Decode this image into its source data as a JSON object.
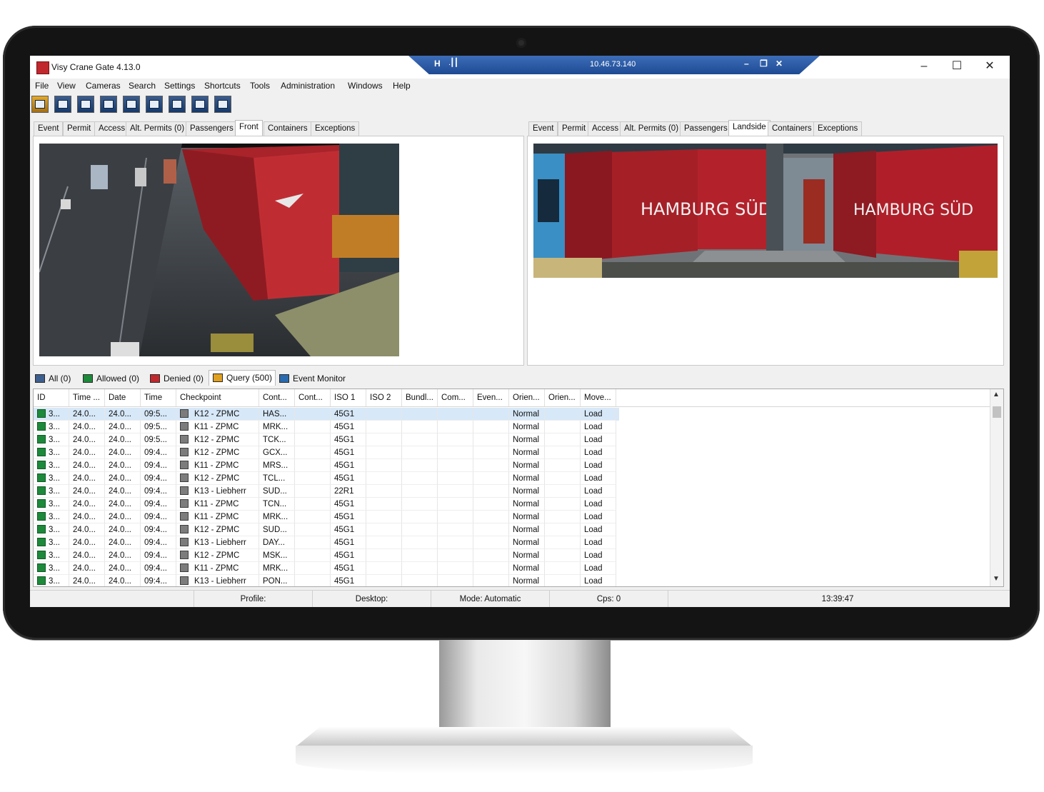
{
  "app": {
    "title": "Visy Crane Gate 4.13.0"
  },
  "remote_bar": {
    "pin_glyph": "⌐",
    "pin_label": "H",
    "signal_glyph": ".┃┃",
    "ip": "10.46.73.140",
    "min": "–",
    "restore": "❐",
    "close": "✕"
  },
  "window_controls": {
    "min": "–",
    "max": "☐",
    "close": "✕"
  },
  "menu": [
    "File",
    "View",
    "Cameras",
    "Search",
    "Settings",
    "Shortcuts",
    "Tools",
    "Administration",
    "Windows",
    "Help"
  ],
  "toolbar_icons": [
    "event-folder-icon",
    "gate-icon",
    "list-icon",
    "camera-icon",
    "image-icon",
    "print-icon",
    "message-icon",
    "window-icon",
    "export-icon"
  ],
  "left_tabs": [
    "Event",
    "Permit",
    "Access",
    "Alt. Permits (0)",
    "Passengers",
    "Front",
    "Containers",
    "Exceptions"
  ],
  "left_active": "Front",
  "right_tabs": [
    "Event",
    "Permit",
    "Access",
    "Alt. Permits (0)",
    "Passengers",
    "Landside",
    "Containers",
    "Exceptions"
  ],
  "right_active": "Landside",
  "right_camera": {
    "container_text_1": "HAMBURG SÜD",
    "container_text_2": "HAMBURG SÜD"
  },
  "query_tabs": [
    {
      "label": "All  (0)",
      "color": "#3d5f8f"
    },
    {
      "label": "Allowed (0)",
      "color": "#1c8a3a"
    },
    {
      "label": "Denied (0)",
      "color": "#c0282e"
    },
    {
      "label": "Query (500)",
      "color": "#e0a020"
    },
    {
      "label": "Event Monitor",
      "color": "#2a6bb0"
    }
  ],
  "query_active": "Query (500)",
  "grid": {
    "columns": [
      "ID",
      "Time ...",
      "Date",
      "Time",
      "Checkpoint",
      "Cont...",
      "Cont...",
      "ISO 1",
      "ISO 2",
      "Bundl...",
      "Com...",
      "Even...",
      "Orien...",
      "Orien...",
      "Move..."
    ],
    "rows": [
      [
        "3...",
        "24.0...",
        "24.0...",
        "09:5...",
        "K12 - ZPMC",
        "HAS...",
        "",
        "45G1",
        "",
        "",
        "",
        "",
        "Normal",
        "",
        "Load"
      ],
      [
        "3...",
        "24.0...",
        "24.0...",
        "09:5...",
        "K11 - ZPMC",
        "MRK...",
        "",
        "45G1",
        "",
        "",
        "",
        "",
        "Normal",
        "",
        "Load"
      ],
      [
        "3...",
        "24.0...",
        "24.0...",
        "09:5...",
        "K12 - ZPMC",
        "TCK...",
        "",
        "45G1",
        "",
        "",
        "",
        "",
        "Normal",
        "",
        "Load"
      ],
      [
        "3...",
        "24.0...",
        "24.0...",
        "09:4...",
        "K12 - ZPMC",
        "GCX...",
        "",
        "45G1",
        "",
        "",
        "",
        "",
        "Normal",
        "",
        "Load"
      ],
      [
        "3...",
        "24.0...",
        "24.0...",
        "09:4...",
        "K11 - ZPMC",
        "MRS...",
        "",
        "45G1",
        "",
        "",
        "",
        "",
        "Normal",
        "",
        "Load"
      ],
      [
        "3...",
        "24.0...",
        "24.0...",
        "09:4...",
        "K12 - ZPMC",
        "TCL...",
        "",
        "45G1",
        "",
        "",
        "",
        "",
        "Normal",
        "",
        "Load"
      ],
      [
        "3...",
        "24.0...",
        "24.0...",
        "09:4...",
        "K13 - Liebherr",
        "SUD...",
        "",
        "22R1",
        "",
        "",
        "",
        "",
        "Normal",
        "",
        "Load"
      ],
      [
        "3...",
        "24.0...",
        "24.0...",
        "09:4...",
        "K11 - ZPMC",
        "TCN...",
        "",
        "45G1",
        "",
        "",
        "",
        "",
        "Normal",
        "",
        "Load"
      ],
      [
        "3...",
        "24.0...",
        "24.0...",
        "09:4...",
        "K11 - ZPMC",
        "MRK...",
        "",
        "45G1",
        "",
        "",
        "",
        "",
        "Normal",
        "",
        "Load"
      ],
      [
        "3...",
        "24.0...",
        "24.0...",
        "09:4...",
        "K12 - ZPMC",
        "SUD...",
        "",
        "45G1",
        "",
        "",
        "",
        "",
        "Normal",
        "",
        "Load"
      ],
      [
        "3...",
        "24.0...",
        "24.0...",
        "09:4...",
        "K13 - Liebherr",
        "DAY...",
        "",
        "45G1",
        "",
        "",
        "",
        "",
        "Normal",
        "",
        "Load"
      ],
      [
        "3...",
        "24.0...",
        "24.0...",
        "09:4...",
        "K12 - ZPMC",
        "MSK...",
        "",
        "45G1",
        "",
        "",
        "",
        "",
        "Normal",
        "",
        "Load"
      ],
      [
        "3...",
        "24.0...",
        "24.0...",
        "09:4...",
        "K11 - ZPMC",
        "MRK...",
        "",
        "45G1",
        "",
        "",
        "",
        "",
        "Normal",
        "",
        "Load"
      ],
      [
        "3...",
        "24.0...",
        "24.0...",
        "09:4...",
        "K13 - Liebherr",
        "PON...",
        "",
        "45G1",
        "",
        "",
        "",
        "",
        "Normal",
        "",
        "Load"
      ]
    ]
  },
  "statusbar": {
    "profile": "Profile:",
    "desktop": "Desktop:",
    "mode": "Mode: Automatic",
    "cps": "Cps: 0",
    "clock": "13:39:47"
  },
  "colors": {
    "status_allowed": "#1c8a3a",
    "remote_bar": "#2a5aa6",
    "selected_row": "#d7e8f8"
  }
}
